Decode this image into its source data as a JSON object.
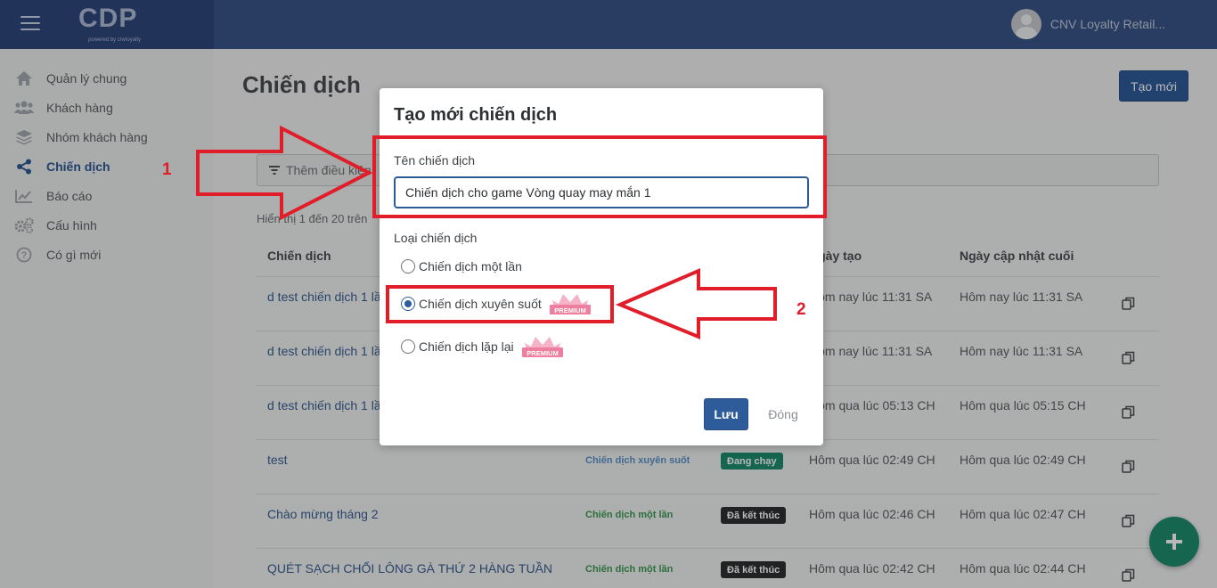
{
  "header": {
    "logo": "CDP",
    "logo_sub": "powered by cnvloyalty",
    "user_name": "CNV Loyalty Retail..."
  },
  "sidebar": {
    "items": [
      {
        "label": "Quản lý chung",
        "icon": "home-icon"
      },
      {
        "label": "Khách hàng",
        "icon": "users-icon"
      },
      {
        "label": "Nhóm khách hàng",
        "icon": "layers-icon"
      },
      {
        "label": "Chiến dịch",
        "icon": "share-icon",
        "active": true
      },
      {
        "label": "Báo cáo",
        "icon": "chart-icon"
      },
      {
        "label": "Cấu hình",
        "icon": "gears-icon"
      },
      {
        "label": "Có gì mới",
        "icon": "question-icon"
      }
    ]
  },
  "main": {
    "title": "Chiến dịch",
    "create_button": "Tạo mới",
    "filter_placeholder": "Thêm điều kiện",
    "showing_text": "Hiển thị 1 đến 20 trên",
    "columns": [
      "Chiến dịch",
      "Ngày tạo",
      "Ngày cập nhật cuối"
    ],
    "rows": [
      {
        "name": "d test chiến dịch 1 lần",
        "type": "",
        "status": "",
        "created": "Hôm nay lúc 11:31 SA",
        "updated": "Hôm nay lúc 11:31 SA"
      },
      {
        "name": "d test chiến dịch 1 lần",
        "type": "",
        "status": "",
        "created": "Hôm nay lúc 11:31 SA",
        "updated": "Hôm nay lúc 11:31 SA"
      },
      {
        "name": "d test chiến dịch 1 lần",
        "type": "",
        "status": "",
        "created": "Hôm qua lúc 05:13 CH",
        "updated": "Hôm qua lúc 05:15 CH"
      },
      {
        "name": "test",
        "type": "Chiến dịch xuyên suốt",
        "status": "Đang chạy",
        "created": "Hôm qua lúc 02:49 CH",
        "updated": "Hôm qua lúc 02:49 CH"
      },
      {
        "name": "Chào mừng tháng 2",
        "type": "Chiến dịch một lần",
        "status": "Đã kết thúc",
        "created": "Hôm qua lúc 02:46 CH",
        "updated": "Hôm qua lúc 02:47 CH"
      },
      {
        "name": "QUÉT SẠCH CHỔI LÔNG GÀ THỨ 2 HÀNG TUẦN",
        "type": "Chiến dịch một lần",
        "status": "Đã kết thúc",
        "created": "Hôm qua lúc 02:42 CH",
        "updated": "Hôm qua lúc 02:44 CH"
      }
    ]
  },
  "modal": {
    "title": "Tạo mới chiến dịch",
    "name_label": "Tên chiến dịch",
    "name_value": "Chiến dịch cho game Vòng quay may mắn 1",
    "type_label": "Loại chiến dịch",
    "options": [
      {
        "label": "Chiến dịch một lần",
        "premium": false,
        "checked": false
      },
      {
        "label": "Chiến dịch xuyên suốt",
        "premium": true,
        "checked": true
      },
      {
        "label": "Chiến dịch lặp lại",
        "premium": true,
        "checked": false
      }
    ],
    "premium_badge": "PREMIUM",
    "save_button": "Lưu",
    "close_button": "Đóng"
  },
  "annotations": {
    "marker_1": "1",
    "marker_2": "2",
    "color": "#e11d2a"
  },
  "colors": {
    "primary": "#2e5c9a",
    "running": "#1f8c6e",
    "ended": "#2d3033"
  }
}
